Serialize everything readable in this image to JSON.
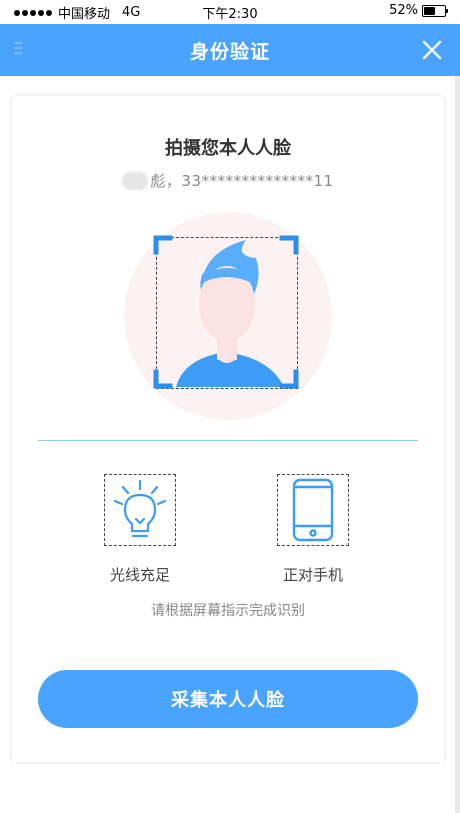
{
  "status_bar": {
    "carrier": "中国移动",
    "network": "4G",
    "time": "下午2:30",
    "battery": "52%",
    "battery_level": 0.52
  },
  "header": {
    "title": "身份验证",
    "close_icon": "close-icon",
    "menu_icon": "menu-icon"
  },
  "card": {
    "title": "拍摄您本人人脸",
    "user_name_suffix": "彪，",
    "user_id": "33**************11"
  },
  "tips": [
    {
      "icon": "lightbulb-icon",
      "label": "光线充足"
    },
    {
      "icon": "phone-icon",
      "label": "正对手机"
    }
  ],
  "instruction": "请根据屏幕指示完成识别",
  "action": {
    "capture_label": "采集本人人脸"
  },
  "colors": {
    "accent": "#4aa3ff",
    "frame_corner": "#2b8ff0",
    "face_bg": "#fdf2f2"
  }
}
